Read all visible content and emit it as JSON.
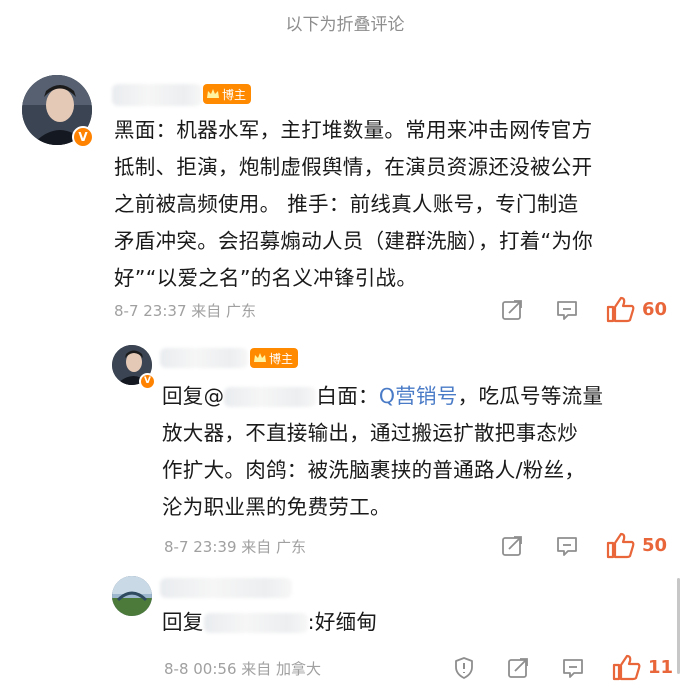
{
  "folded_note": "以下为折叠评论",
  "comments": [
    {
      "author_badge": "博主",
      "text": "黑面：机器水军，主打堆数量。常用来冲击网传官方抵制、拒演，炮制虚假舆情，在演员资源还没被公开之前被高频使用。推手：前线真人账号，专门制造矛盾冲突。会招募煽动人员（建群洗脑），打着“为你好”“以爱之名”的名义冲锋引战。",
      "lines": [
        "黑面：机器水军，主打堆数量。常用来冲击网传官方",
        "抵制、拒演，炮制虚假舆情，在演员资源还没被公开",
        "之前被高频使用。 推手：前线真人账号，专门制造",
        "矛盾冲突。会招募煽动人员（建群洗脑），打着“为你",
        "好”“以爱之名”的名义冲锋引战。"
      ],
      "time": "8-7 23:37",
      "location": "来自 广东",
      "likes": "60"
    },
    {
      "author_badge": "博主",
      "reply_prefix": "回复@",
      "reply_suffix": "白面：",
      "link_text": "Q营销号",
      "lines_rest": [
        "，吃瓜号等流量",
        "放大器，不直接输出，通过搬运扩散把事态炒",
        "作扩大。肉鸽：被洗脑裹挟的普通路人/粉丝，",
        "沦为职业黑的免费劳工。"
      ],
      "time": "8-7 23:39",
      "location": "来自 广东",
      "likes": "50"
    },
    {
      "reply_prefix": "回复",
      "reply_suffix": ":好缅甸",
      "time": "8-8 00:56",
      "location": "来自 加拿大",
      "likes": "11"
    }
  ],
  "icons": {
    "share": "share-icon",
    "comment": "comment-icon",
    "like": "thumbs-up-icon",
    "report": "shield-alert-icon",
    "verified": "verified-v-icon",
    "crown": "crown-icon"
  },
  "colors": {
    "accent": "#ff8200",
    "like": "#e8663a",
    "link": "#4a7bc7",
    "meta": "#a0a0a0"
  }
}
